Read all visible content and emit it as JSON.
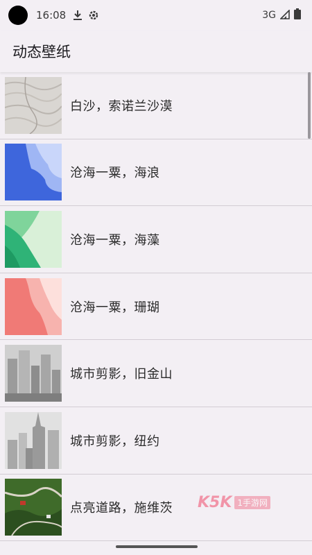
{
  "status_bar": {
    "time": "16:08",
    "network": "3G",
    "icons": [
      "download-icon",
      "settings-gear-icon",
      "signal-icon",
      "battery-icon"
    ]
  },
  "app_bar": {
    "title": "动态壁纸"
  },
  "wallpapers": [
    {
      "label": "白沙，索诺兰沙漠",
      "thumb": "sand-dunes"
    },
    {
      "label": "沧海一粟，海浪",
      "thumb": "blue-waves"
    },
    {
      "label": "沧海一粟，海藻",
      "thumb": "green-seaweed"
    },
    {
      "label": "沧海一粟，珊瑚",
      "thumb": "pink-coral"
    },
    {
      "label": "城市剪影，旧金山",
      "thumb": "city-san-francisco"
    },
    {
      "label": "城市剪影，纽约",
      "thumb": "city-new-york"
    },
    {
      "label": "点亮道路，施维茨",
      "thumb": "road-schwyz"
    }
  ],
  "watermark": {
    "brand": "K5K",
    "text": "1手游网"
  },
  "colors": {
    "background": "#f3eff4",
    "divider": "#d2ccd3"
  }
}
